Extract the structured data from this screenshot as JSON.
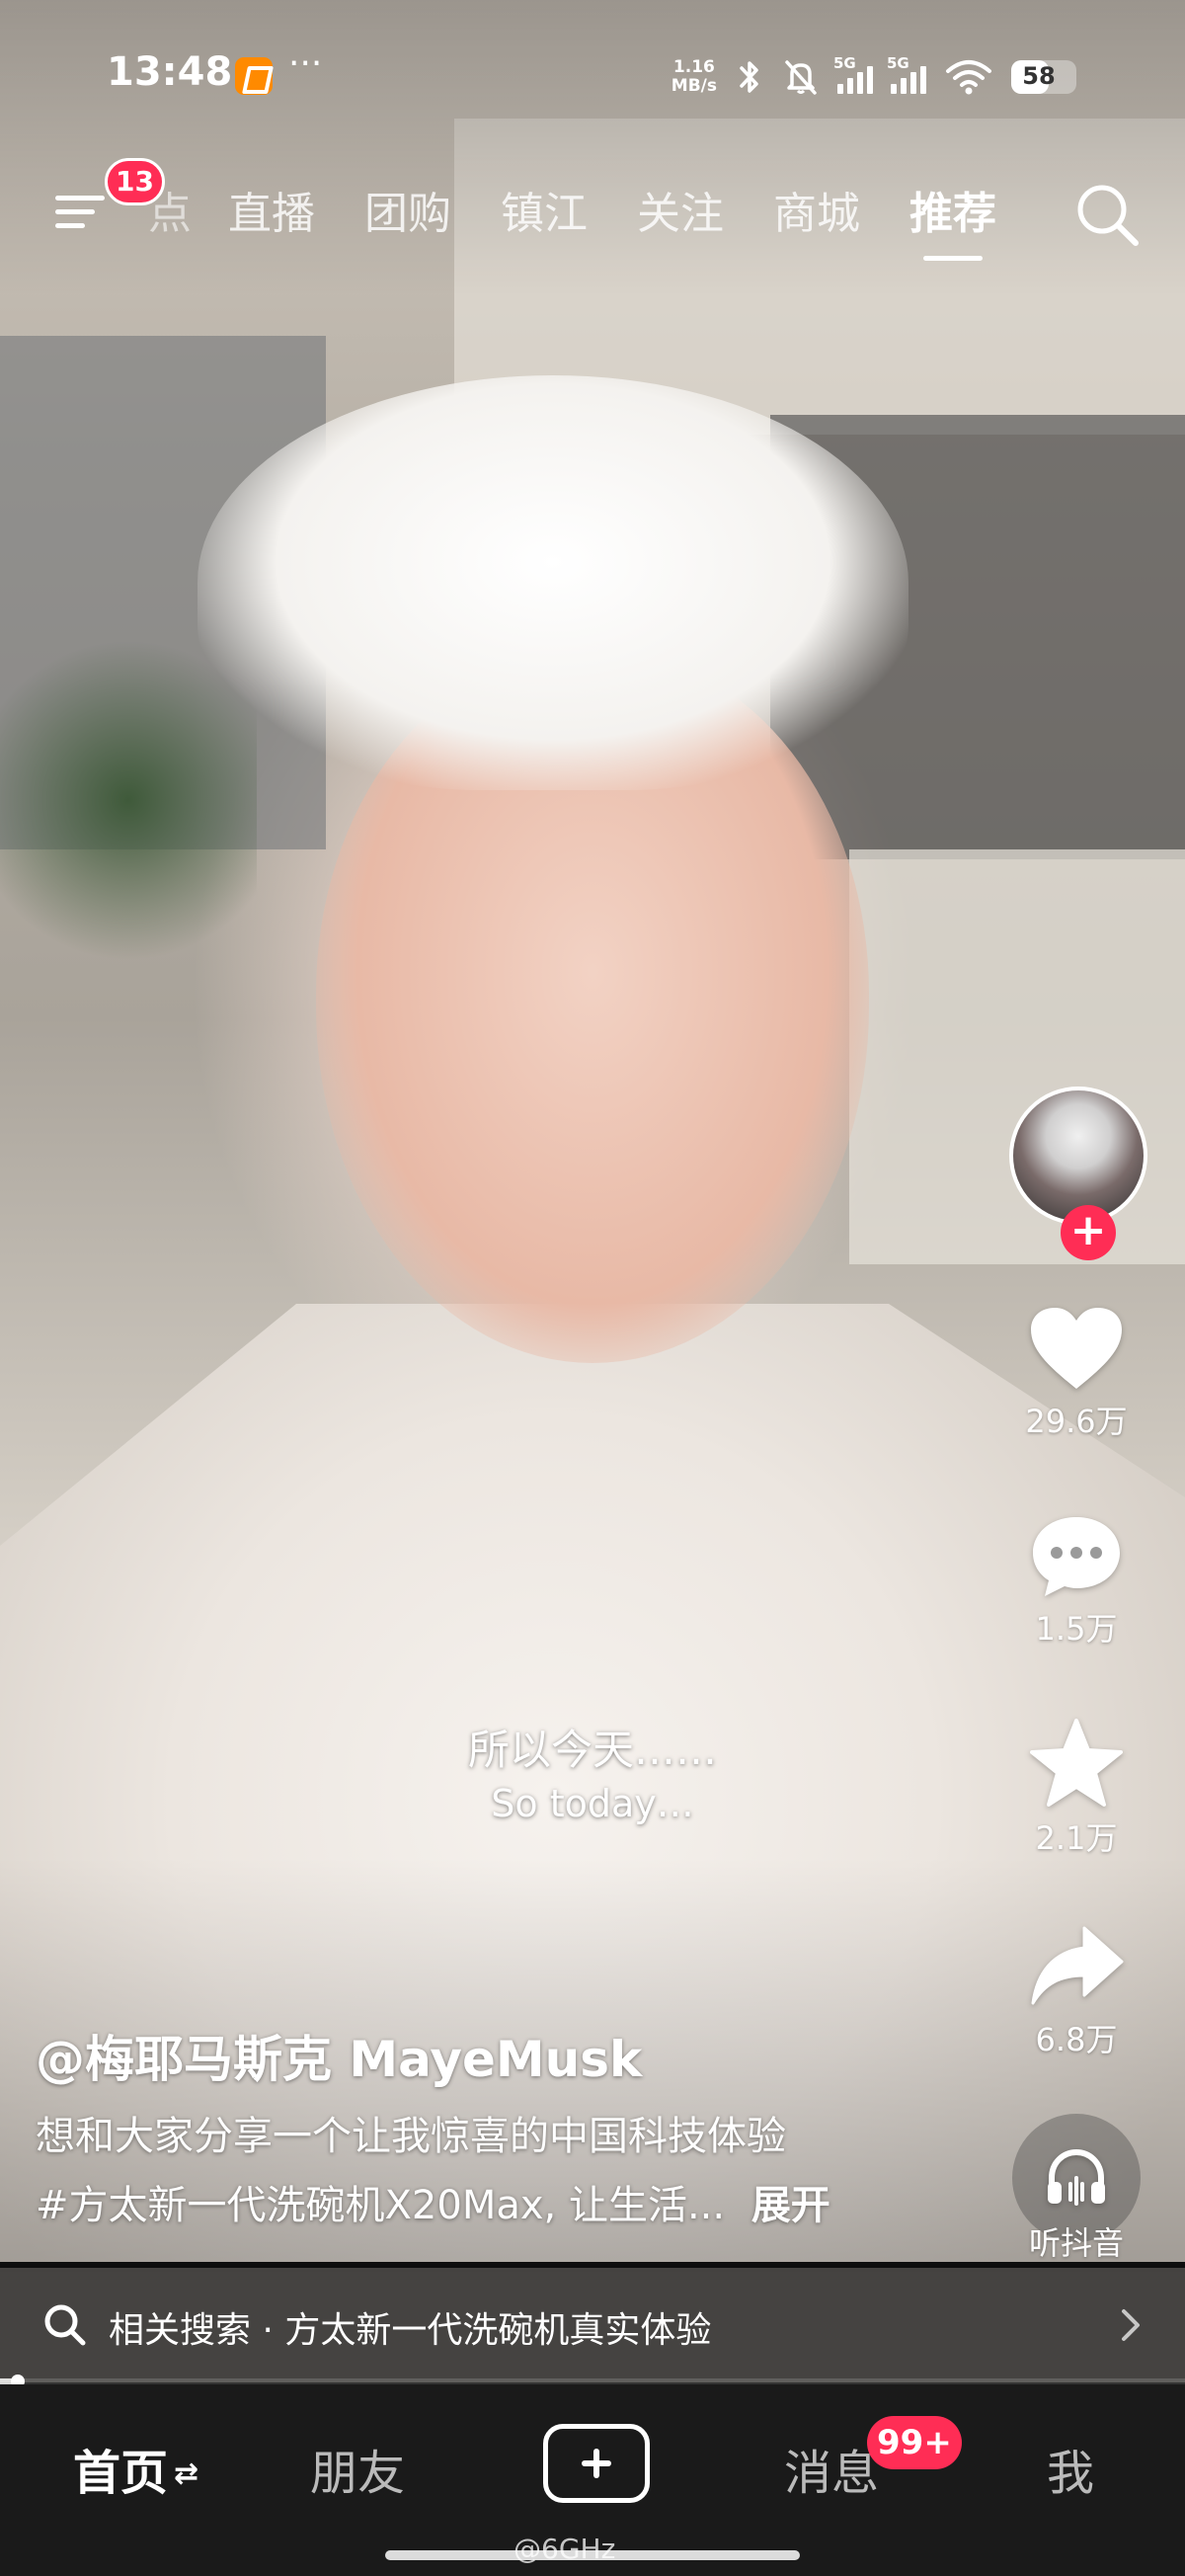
{
  "status_bar": {
    "time": "13:48",
    "more": "···",
    "net_speed_value": "1.16",
    "net_speed_unit": "MB/s",
    "signal1_label": "5G",
    "signal2_label": "5G",
    "battery": "58",
    "battery_level": 0.58,
    "icons": [
      "app-notification-icon",
      "bluetooth-icon",
      "mute-bell-icon",
      "signal-icon",
      "wifi-icon",
      "battery-icon"
    ]
  },
  "top_nav": {
    "menu_badge": "13",
    "tabs": [
      {
        "label": "点"
      },
      {
        "label": "直播"
      },
      {
        "label": "团购"
      },
      {
        "label": "镇江"
      },
      {
        "label": "关注"
      },
      {
        "label": "商城"
      },
      {
        "label": "推荐"
      }
    ],
    "active_tab": "推荐"
  },
  "right_rail": {
    "likes": "29.6万",
    "comments": "1.5万",
    "favorites": "2.1万",
    "shares": "6.8万",
    "music": "听抖音"
  },
  "subtitles": {
    "cn": "所以今天……",
    "en": "So today…"
  },
  "post": {
    "author": "@梅耶马斯克 MayeMusk",
    "desc_line1": "想和大家分享一个让我惊喜的中国科技体验",
    "desc_line2": "#方太新一代洗碗机X20Max, 让生活...",
    "expand": "展开"
  },
  "related_search": {
    "label": "相关搜索 · 方太新一代洗碗机真实体验"
  },
  "progress": {
    "fraction": 0.015
  },
  "bottom_nav": {
    "home": "首页",
    "home_switch": "⇄",
    "friends": "朋友",
    "messages": "消息",
    "messages_badge": "99+",
    "me": "我",
    "watermark": "@6GHz"
  },
  "colors": {
    "accent": "#ff2d55",
    "nav_bg": "#1a1a1a"
  }
}
